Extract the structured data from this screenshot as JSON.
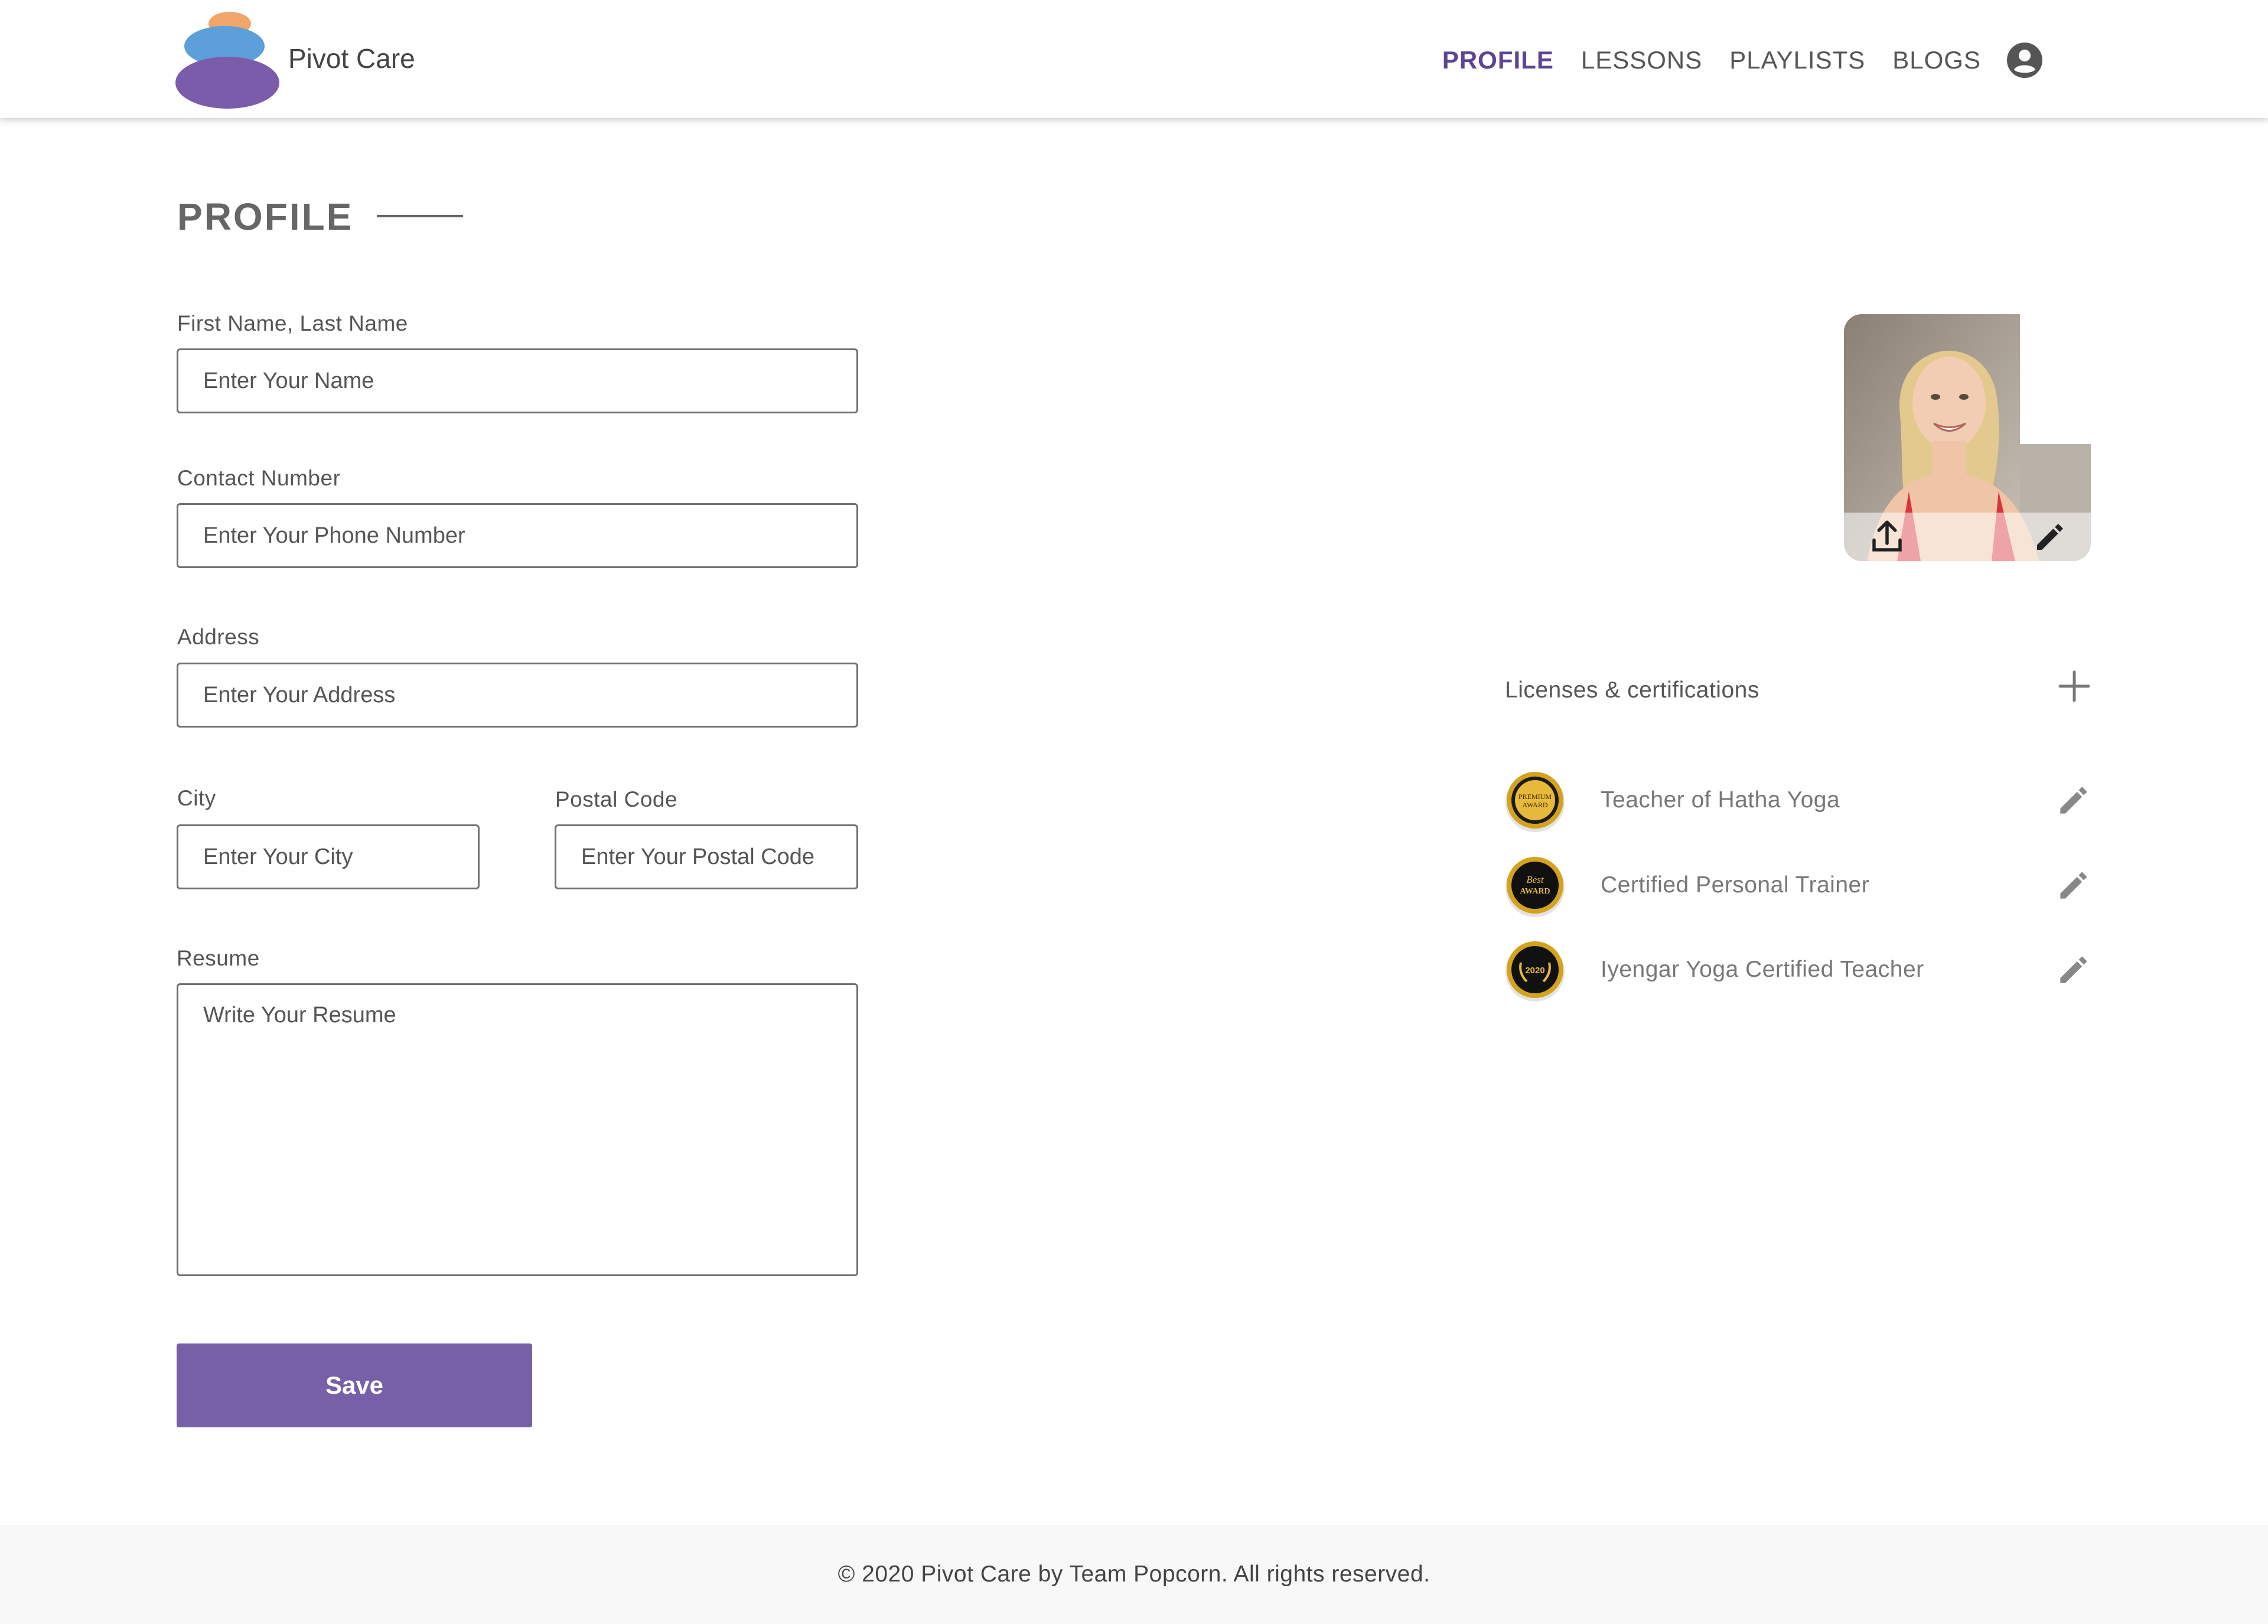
{
  "header": {
    "brand": "Pivot Care",
    "nav": [
      "PROFILE",
      "LESSONS",
      "PLAYLISTS",
      "BLOGS"
    ],
    "active_nav": "PROFILE",
    "account_icon": "account-circle-icon"
  },
  "profile": {
    "title": "PROFILE"
  },
  "form": {
    "name_label": "First Name, Last Name",
    "name_placeholder": "Enter Your Name",
    "contact_label": "Contact Number",
    "contact_placeholder": "Enter Your Phone Number",
    "address_label": "Address",
    "address_placeholder": "Enter Your Address",
    "city_label": "City",
    "city_placeholder": "Enter Your City",
    "postal_label": "Postal Code",
    "postal_placeholder": "Enter Your Postal Code",
    "resume_label": "Resume",
    "resume_placeholder": "Write Your Resume",
    "save_label": "Save"
  },
  "licenses": {
    "title": "Licenses & certifications",
    "items": [
      {
        "label": "Teacher of Hatha Yoga",
        "badge_text": "PREMIUM AWARD"
      },
      {
        "label": "Certified Personal Trainer",
        "badge_text": "Best AWARD"
      },
      {
        "label": "Iyengar Yoga Certified Teacher",
        "badge_text": "2020"
      }
    ]
  },
  "footer": {
    "text": "©  2020 Pivot Care by Team Popcorn. All rights reserved."
  },
  "colors": {
    "accent": "#7860a8",
    "active_nav": "#5d4394",
    "logo_orange": "#f0a56a",
    "logo_blue": "#5d9fd8",
    "logo_purple": "#7a5cab",
    "badge_gold": "#d4a21c"
  }
}
